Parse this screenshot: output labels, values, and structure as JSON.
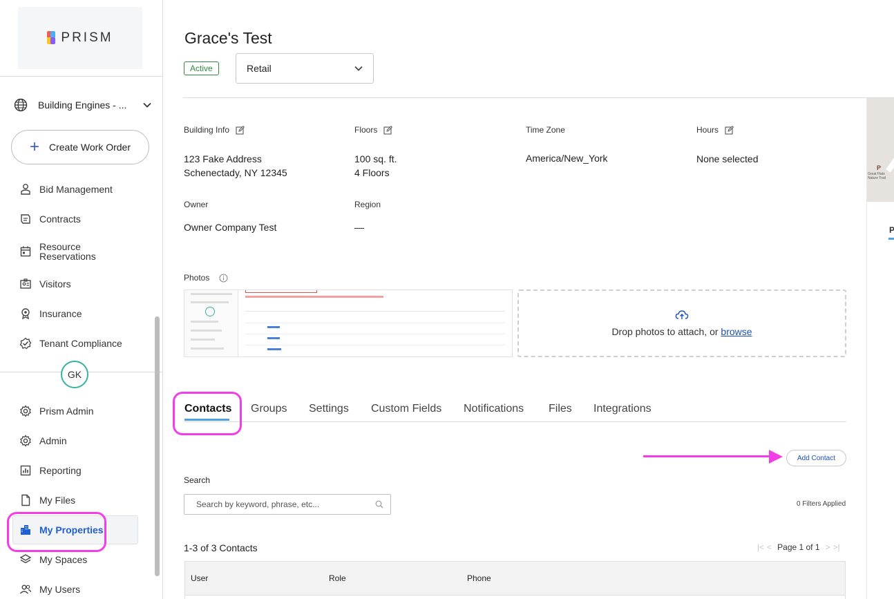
{
  "brand": {
    "name": "PRISM"
  },
  "sidebar": {
    "org": "Building Engines - ...",
    "create_button": "Create Work Order",
    "nav_top": [
      {
        "label": "Bid Management",
        "icon": "hammer-icon"
      },
      {
        "label": "Contracts",
        "icon": "contract-icon"
      },
      {
        "label": "Resource Reservations",
        "icon": "calendar-icon"
      },
      {
        "label": "Visitors",
        "icon": "badge-icon"
      },
      {
        "label": "Insurance",
        "icon": "shield-icon"
      },
      {
        "label": "Tenant Compliance",
        "icon": "check-badge-icon"
      }
    ],
    "avatar_initials": "GK",
    "nav_bottom": [
      {
        "label": "Prism Admin",
        "icon": "gear-icon"
      },
      {
        "label": "Admin",
        "icon": "gear-icon"
      },
      {
        "label": "Reporting",
        "icon": "chart-icon"
      },
      {
        "label": "My Files",
        "icon": "file-icon"
      },
      {
        "label": "My Properties",
        "icon": "building-icon",
        "active": true
      },
      {
        "label": "My Spaces",
        "icon": "layers-icon"
      },
      {
        "label": "My Users",
        "icon": "users-icon"
      }
    ]
  },
  "property": {
    "title": "Grace's Test",
    "status": "Active",
    "type": "Retail"
  },
  "info": {
    "building_info_label": "Building Info",
    "address_line1": "123 Fake Address",
    "address_line2": "Schenectady, NY 12345",
    "floors_label": "Floors",
    "floors_area": "100 sq. ft.",
    "floors_count": "4 Floors",
    "timezone_label": "Time Zone",
    "timezone": "America/New_York",
    "hours_label": "Hours",
    "hours": "None selected",
    "owner_label": "Owner",
    "owner": "Owner Company Test",
    "region_label": "Region",
    "region": "—",
    "photos_label": "Photos"
  },
  "dropzone": {
    "text": "Drop photos to attach, or ",
    "link": "browse"
  },
  "map": {
    "label": "Great Flats Nature Trail",
    "side_tab": "P"
  },
  "tabs": [
    "Contacts",
    "Groups",
    "Settings",
    "Custom Fields",
    "Notifications",
    "Files",
    "Integrations"
  ],
  "contacts": {
    "add_button": "Add Contact",
    "search_label": "Search",
    "search_placeholder": "Search by keyword, phrase, etc...",
    "filters": "0 Filters Applied",
    "count": "1-3 of 3 Contacts",
    "page": "Page 1 of 1",
    "columns": [
      "User",
      "Role",
      "Phone"
    ]
  },
  "colors": {
    "accent": "#1f5fd1",
    "highlight": "#f23ee6",
    "active_tab": "#4ea1e8",
    "status_green": "#2e8b3e"
  }
}
